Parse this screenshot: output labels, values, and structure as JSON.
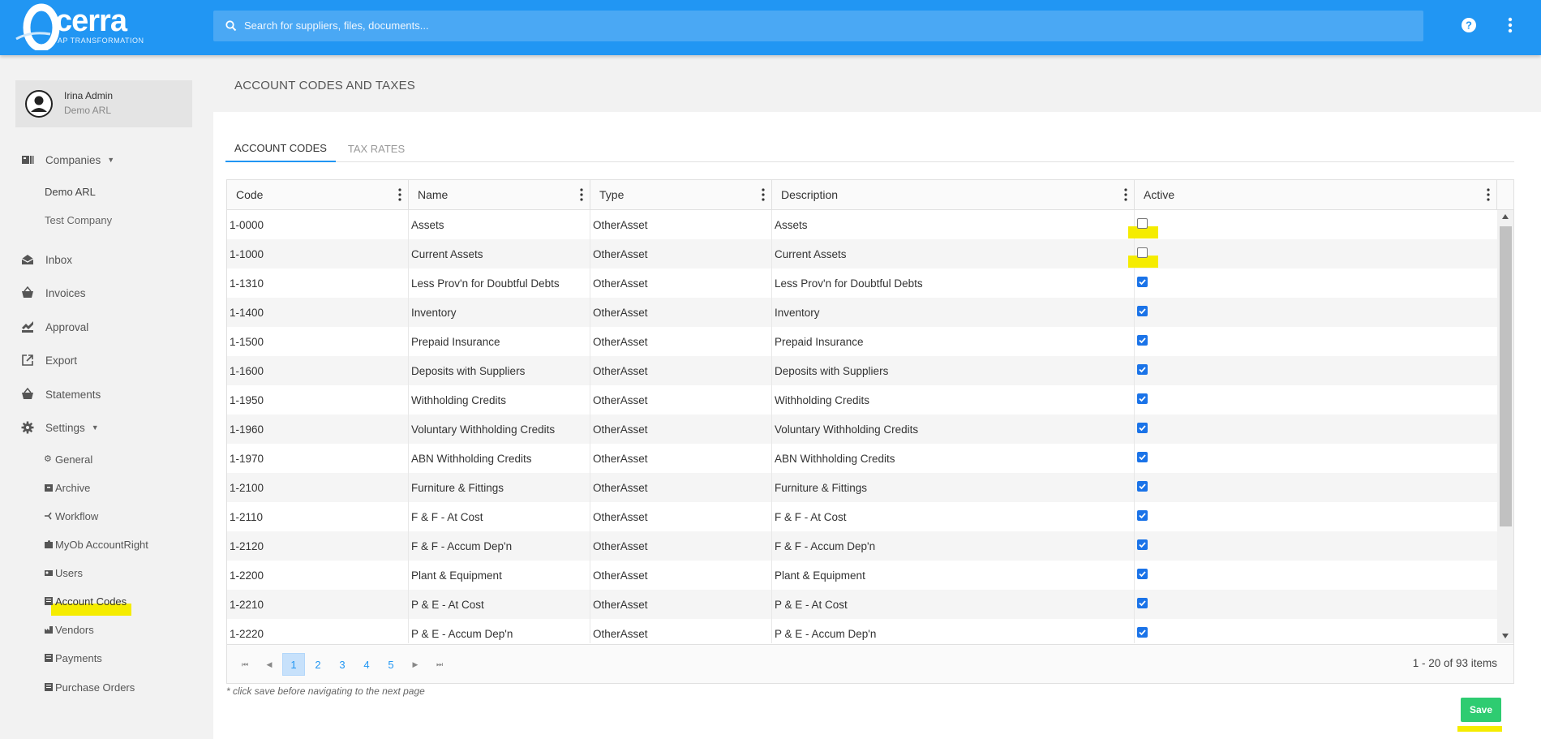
{
  "app": {
    "logo_word": "cerra",
    "logo_tagline": "AP TRANSFORMATION",
    "search_placeholder": "Search for suppliers, files, documents..."
  },
  "user": {
    "name": "Irina Admin",
    "org": "Demo ARL"
  },
  "nav": {
    "companies": "Companies",
    "company_list": [
      "Demo ARL",
      "Test Company"
    ],
    "items": [
      "Inbox",
      "Invoices",
      "Approval",
      "Export",
      "Statements"
    ],
    "settings": "Settings",
    "settings_items": [
      "General",
      "Archive",
      "Workflow",
      "MyOb AccountRight",
      "Users",
      "Account Codes",
      "Vendors",
      "Payments",
      "Purchase Orders"
    ]
  },
  "page": {
    "title": "ACCOUNT CODES AND TAXES",
    "tabs": [
      "ACCOUNT CODES",
      "TAX RATES"
    ],
    "active_tab": "ACCOUNT CODES"
  },
  "grid": {
    "columns": [
      "Code",
      "Name",
      "Type",
      "Description",
      "Active"
    ],
    "rows": [
      {
        "code": "1-0000",
        "name": "Assets",
        "type": "OtherAsset",
        "description": "Assets",
        "active": false
      },
      {
        "code": "1-1000",
        "name": "Current Assets",
        "type": "OtherAsset",
        "description": "Current Assets",
        "active": false
      },
      {
        "code": "1-1310",
        "name": "Less Prov'n for Doubtful Debts",
        "type": "OtherAsset",
        "description": "Less Prov'n for Doubtful Debts",
        "active": true
      },
      {
        "code": "1-1400",
        "name": "Inventory",
        "type": "OtherAsset",
        "description": "Inventory",
        "active": true
      },
      {
        "code": "1-1500",
        "name": "Prepaid Insurance",
        "type": "OtherAsset",
        "description": "Prepaid Insurance",
        "active": true
      },
      {
        "code": "1-1600",
        "name": "Deposits with Suppliers",
        "type": "OtherAsset",
        "description": "Deposits with Suppliers",
        "active": true
      },
      {
        "code": "1-1950",
        "name": "Withholding Credits",
        "type": "OtherAsset",
        "description": "Withholding Credits",
        "active": true
      },
      {
        "code": "1-1960",
        "name": "Voluntary Withholding Credits",
        "type": "OtherAsset",
        "description": "Voluntary Withholding Credits",
        "active": true
      },
      {
        "code": "1-1970",
        "name": "ABN Withholding Credits",
        "type": "OtherAsset",
        "description": "ABN Withholding Credits",
        "active": true
      },
      {
        "code": "1-2100",
        "name": "Furniture & Fittings",
        "type": "OtherAsset",
        "description": "Furniture & Fittings",
        "active": true
      },
      {
        "code": "1-2110",
        "name": "F & F - At Cost",
        "type": "OtherAsset",
        "description": "F & F - At Cost",
        "active": true
      },
      {
        "code": "1-2120",
        "name": "F & F - Accum Dep'n",
        "type": "OtherAsset",
        "description": "F & F - Accum Dep'n",
        "active": true
      },
      {
        "code": "1-2200",
        "name": "Plant & Equipment",
        "type": "OtherAsset",
        "description": "Plant & Equipment",
        "active": true
      },
      {
        "code": "1-2210",
        "name": "P & E - At Cost",
        "type": "OtherAsset",
        "description": "P & E - At Cost",
        "active": true
      },
      {
        "code": "1-2220",
        "name": "P & E - Accum Dep'n",
        "type": "OtherAsset",
        "description": "P & E - Accum Dep'n",
        "active": true
      }
    ]
  },
  "pager": {
    "pages": [
      "1",
      "2",
      "3",
      "4",
      "5"
    ],
    "current": "1",
    "info": "1 - 20 of 93 items"
  },
  "footer": {
    "note": "* click save before navigating to the next page",
    "save_label": "Save"
  },
  "colors": {
    "primary": "#2196f3",
    "save": "#2ecc71",
    "highlight": "#f5ec00",
    "checkbox": "#1a73e8"
  }
}
